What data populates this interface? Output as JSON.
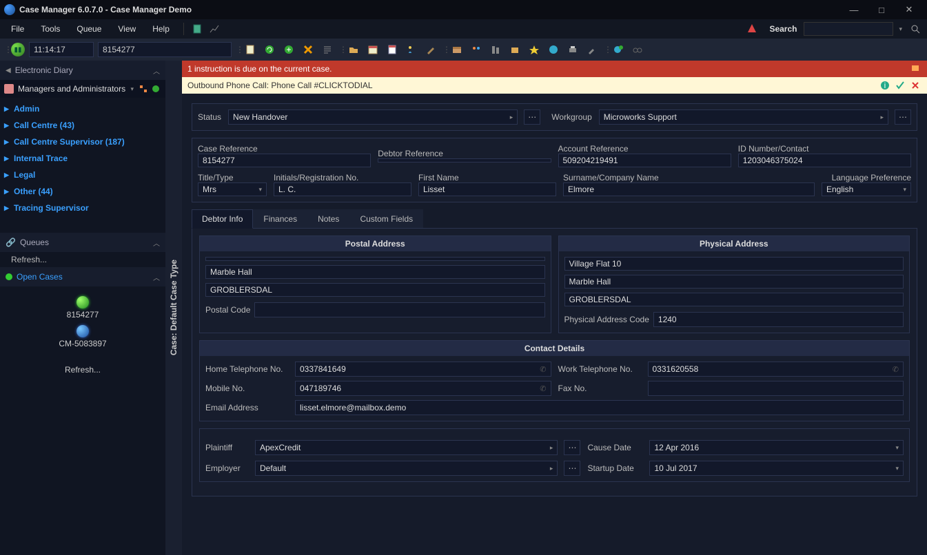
{
  "window": {
    "title": "Case Manager 6.0.7.0 - Case Manager Demo"
  },
  "menu": {
    "items": [
      "File",
      "Tools",
      "Queue",
      "View",
      "Help"
    ],
    "search_label": "Search"
  },
  "toolbar": {
    "clock": "11:14:17",
    "case_quick": "8154277"
  },
  "sidebar": {
    "diary_title": "Electronic Diary",
    "managers_title": "Managers and Administrators",
    "groups": [
      {
        "label": "Admin"
      },
      {
        "label": "Call Centre (43)"
      },
      {
        "label": "Call Centre Supervisor (187)"
      },
      {
        "label": "Internal Trace"
      },
      {
        "label": "Legal"
      },
      {
        "label": "Other (44)"
      },
      {
        "label": "Tracing Supervisor"
      }
    ],
    "queues_title": "Queues",
    "queues_refresh": "Refresh...",
    "open_cases_title": "Open Cases",
    "open_cases": [
      {
        "id": "8154277",
        "color": "green"
      },
      {
        "id": "CM-5083897",
        "color": "blue"
      }
    ],
    "open_refresh": "Refresh..."
  },
  "vstrip": "Case: Default Case Type",
  "banners": {
    "alert": "1 instruction is due on the current case.",
    "call": "Outbound Phone Call: Phone Call #CLICKTODIAL"
  },
  "form": {
    "status_label": "Status",
    "status_value": "New Handover",
    "workgroup_label": "Workgroup",
    "workgroup_value": "Microworks Support",
    "case_ref_label": "Case Reference",
    "case_ref_value": "8154277",
    "debtor_ref_label": "Debtor Reference",
    "debtor_ref_value": "",
    "acct_ref_label": "Account Reference",
    "acct_ref_value": "509204219491",
    "id_label": "ID Number/Contact",
    "id_value": "1203046375024",
    "title_label": "Title/Type",
    "title_value": "Mrs",
    "initials_label": "Initials/Registration No.",
    "initials_value": "L. C.",
    "firstname_label": "First Name",
    "firstname_value": "Lisset",
    "surname_label": "Surname/Company Name",
    "surname_value": "Elmore",
    "lang_label": "Language Preference",
    "lang_value": "English"
  },
  "tabs": [
    "Debtor Info",
    "Finances",
    "Notes",
    "Custom Fields"
  ],
  "debtor": {
    "postal_title": "Postal Address",
    "postal_line1": "",
    "postal_line2": "Marble Hall",
    "postal_line3": "GROBLERSDAL",
    "postal_code_label": "Postal Code",
    "postal_code_value": "",
    "physical_title": "Physical Address",
    "physical_line1": "Village Flat 10",
    "physical_line2": "Marble Hall",
    "physical_line3": "GROBLERSDAL",
    "physical_code_label": "Physical Address Code",
    "physical_code_value": "1240",
    "contact_title": "Contact Details",
    "home_tel_label": "Home Telephone No.",
    "home_tel_value": "0337841649",
    "work_tel_label": "Work Telephone No.",
    "work_tel_value": "0331620558",
    "mobile_label": "Mobile No.",
    "mobile_value": "047189746",
    "fax_label": "Fax No.",
    "fax_value": "",
    "email_label": "Email Address",
    "email_value": "lisset.elmore@mailbox.demo",
    "plaintiff_label": "Plaintiff",
    "plaintiff_value": "ApexCredit",
    "cause_date_label": "Cause Date",
    "cause_date_value": "12 Apr 2016",
    "employer_label": "Employer",
    "employer_value": "Default",
    "startup_date_label": "Startup Date",
    "startup_date_value": "10 Jul 2017"
  }
}
